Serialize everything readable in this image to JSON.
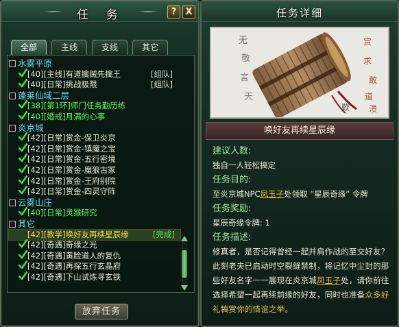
{
  "quest_window": {
    "title": "任 务",
    "help_label": "?",
    "close_label": "X",
    "tabs": [
      {
        "label": "全部",
        "active": true
      },
      {
        "label": "主线",
        "active": false
      },
      {
        "label": "支线",
        "active": false
      },
      {
        "label": "其它",
        "active": false
      }
    ],
    "abandon_label": "放弃任务",
    "list": [
      {
        "type": "cat",
        "label": "水雾平原"
      },
      {
        "type": "quest",
        "level": "[40]",
        "text": "[主线]有道擒贼先擒王",
        "color": "white",
        "party": "[组队]"
      },
      {
        "type": "quest",
        "level": "[40]",
        "text": "[日常]挑战极限",
        "color": "white",
        "party": "[组队]"
      },
      {
        "type": "cat",
        "label": "蓬莱仙域二层"
      },
      {
        "type": "quest",
        "level": "[38]",
        "text": "[第1环]师门任务勤历练",
        "color": "green"
      },
      {
        "type": "quest",
        "level": "[40]",
        "text": "[婚戒]月满的心事",
        "color": "green"
      },
      {
        "type": "cat",
        "label": "炎京城"
      },
      {
        "type": "quest",
        "level": "[42]",
        "text": "[日常]赏金-保卫炎京",
        "color": "white"
      },
      {
        "type": "quest",
        "level": "[42]",
        "text": "[日常]赏金-镇魔之宝",
        "color": "white"
      },
      {
        "type": "quest",
        "level": "[42]",
        "text": "[日常]赏金-五行密境",
        "color": "white"
      },
      {
        "type": "quest",
        "level": "[42]",
        "text": "[日常]赏金-魔狼古冢",
        "color": "white"
      },
      {
        "type": "quest",
        "level": "[42]",
        "text": "[日常]赏金-王府别院",
        "color": "white"
      },
      {
        "type": "quest",
        "level": "[42]",
        "text": "[日常]赏金-四灵守阵",
        "color": "white"
      },
      {
        "type": "cat",
        "label": "云雾山庄"
      },
      {
        "type": "quest",
        "level": "[40]",
        "text": "[日常]灵猴研究",
        "color": "green"
      },
      {
        "type": "cat",
        "label": "其它"
      },
      {
        "type": "quest",
        "level": "[42]",
        "text": "[教学]唤好友再续星辰缘",
        "color": "yellow",
        "done": "[完成]",
        "selected": true,
        "unchecked": true
      },
      {
        "type": "quest",
        "level": "[42]",
        "text": "[奇遇]奇缘之光",
        "color": "white"
      },
      {
        "type": "quest",
        "level": "[42]",
        "text": "[奇遇]黄脸道人的复仇",
        "color": "white"
      },
      {
        "type": "quest",
        "level": "[42]",
        "text": "[奇遇]再探五行玄晶府",
        "color": "white"
      },
      {
        "type": "quest",
        "level": "[42]",
        "text": "[奇遇]下山试炼寻玄铁",
        "color": "white"
      }
    ]
  },
  "detail_window": {
    "title": "任务详细",
    "quest_name": "唤好友再续星辰缘",
    "people_label": "建议人数:",
    "people_value": "独自一人轻松搞定",
    "goal_label": "任务目的:",
    "goal_prefix": "至炎京城NPC",
    "goal_npc": "凤玉子",
    "goal_suffix": "处领取 “星辰奇缘” 令牌",
    "reward_label": "任务奖励:",
    "reward_value": "星辰奇缘令牌: 1",
    "desc_label": "任务描述:",
    "desc_part1": "修真者，是否记得曾经一起并肩作战的至交好友？此刻老夫已启动时空裂缝禁制，将记忆中尘封的那些好友名字一一展现在炎京城",
    "desc_npc": "凤玉子",
    "desc_part2": "处，请你前往选择希望一起再续前缘的好友，同时也准备",
    "desc_gold": "众多好礼犒赏你的情谊之举。",
    "scroll_glyphs": [
      "无",
      "敬",
      "言",
      "天",
      "歎",
      "赏",
      "求",
      "敢",
      "道",
      "溃"
    ]
  },
  "colors": {
    "category": "#6fd7f3",
    "quest_white": "#ece8d4",
    "quest_green": "#61f559",
    "quest_yellow": "#f2d458",
    "detail_heading": "#a3e8a0",
    "npc_highlight": "#f0c24a"
  }
}
